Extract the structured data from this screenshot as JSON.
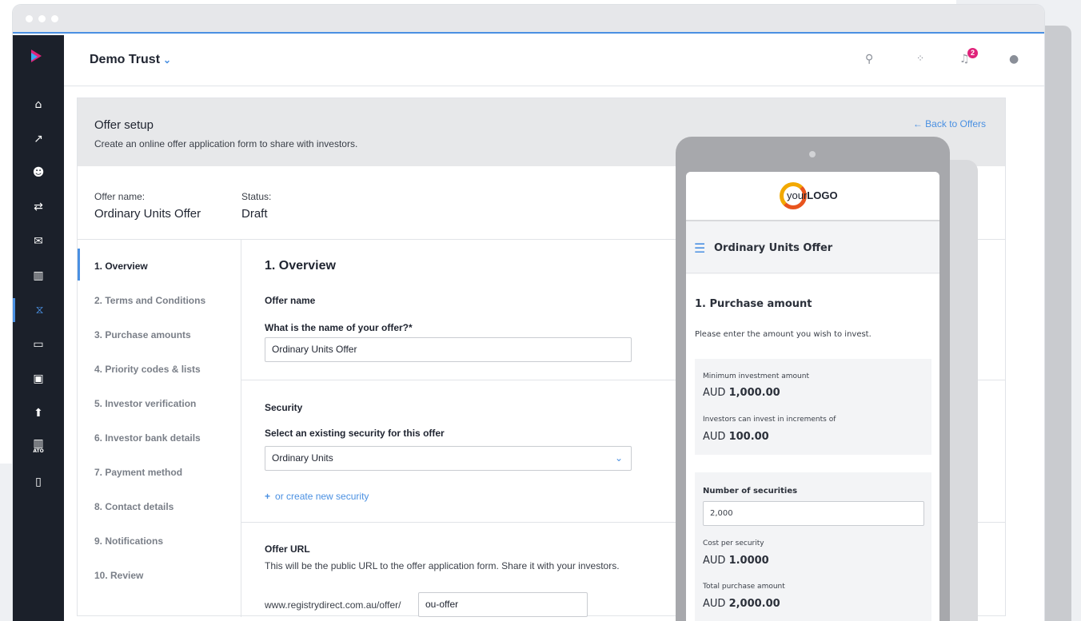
{
  "app": {
    "trust_name": "Demo Trust",
    "notification_count": "2"
  },
  "sidebar": {
    "items": [
      {
        "icon": "bank-icon",
        "glyph": "🏛"
      },
      {
        "icon": "chart-line-icon",
        "glyph": "📈"
      },
      {
        "icon": "users-icon",
        "glyph": "👥"
      },
      {
        "icon": "transfer-icon",
        "glyph": "⇄"
      },
      {
        "icon": "mail-icon",
        "glyph": "✉"
      },
      {
        "icon": "bar-chart-icon",
        "glyph": "📊"
      },
      {
        "icon": "handshake-icon",
        "glyph": "🤝"
      },
      {
        "icon": "calendar-icon",
        "glyph": "▭"
      },
      {
        "icon": "money-icon",
        "glyph": "💵"
      },
      {
        "icon": "upload-icon",
        "glyph": "⬆"
      },
      {
        "icon": "ato-report-icon",
        "glyph": "📊"
      },
      {
        "icon": "clipboard-icon",
        "glyph": "📋"
      }
    ],
    "ato_label": "ATO"
  },
  "header": {
    "title": "Offer setup",
    "subtitle": "Create an online offer application form to share with investors.",
    "back_link": "← Back to Offers"
  },
  "meta": {
    "name_label": "Offer name:",
    "name_value": "Ordinary Units Offer",
    "status_label": "Status:",
    "status_value": "Draft"
  },
  "steps": [
    "1. Overview",
    "2. Terms and Conditions",
    "3. Purchase amounts",
    "4. Priority codes & lists",
    "5. Investor verification",
    "6. Investor bank details",
    "7. Payment method",
    "8. Contact details",
    "9. Notifications",
    "10. Review"
  ],
  "form": {
    "section_title": "1. Overview",
    "offer_name_heading": "Offer name",
    "offer_name_question": "What is the name of your offer?*",
    "offer_name_value": "Ordinary Units Offer",
    "security_heading": "Security",
    "security_question": "Select an existing security for this offer",
    "security_value": "Ordinary Units",
    "create_security": "or create new security",
    "url_heading": "Offer URL",
    "url_description": "This will be the public URL to the offer application form. Share it with your investors.",
    "url_prefix": "www.registrydirect.com.au/offer/",
    "url_slug": "ou-offer"
  },
  "preview": {
    "logo_your": "your",
    "logo_logo": "LOGO",
    "nav_title": "Ordinary Units Offer",
    "heading": "1. Purchase amount",
    "intro": "Please enter the amount you wish to invest.",
    "min_label": "Minimum investment amount",
    "min_currency": "AUD",
    "min_value": "1,000.00",
    "inc_label": "Investors can invest in increments of",
    "inc_currency": "AUD",
    "inc_value": "100.00",
    "num_label": "Number of securities",
    "num_value": "2,000",
    "cost_label": "Cost per security",
    "cost_currency": "AUD",
    "cost_value": "1.0000",
    "total_label": "Total purchase amount",
    "total_currency": "AUD",
    "total_value": "2,000.00"
  },
  "colors": {
    "accent": "#4a90e2",
    "sidebar_bg": "#1b202a",
    "badge": "#e0227a"
  }
}
